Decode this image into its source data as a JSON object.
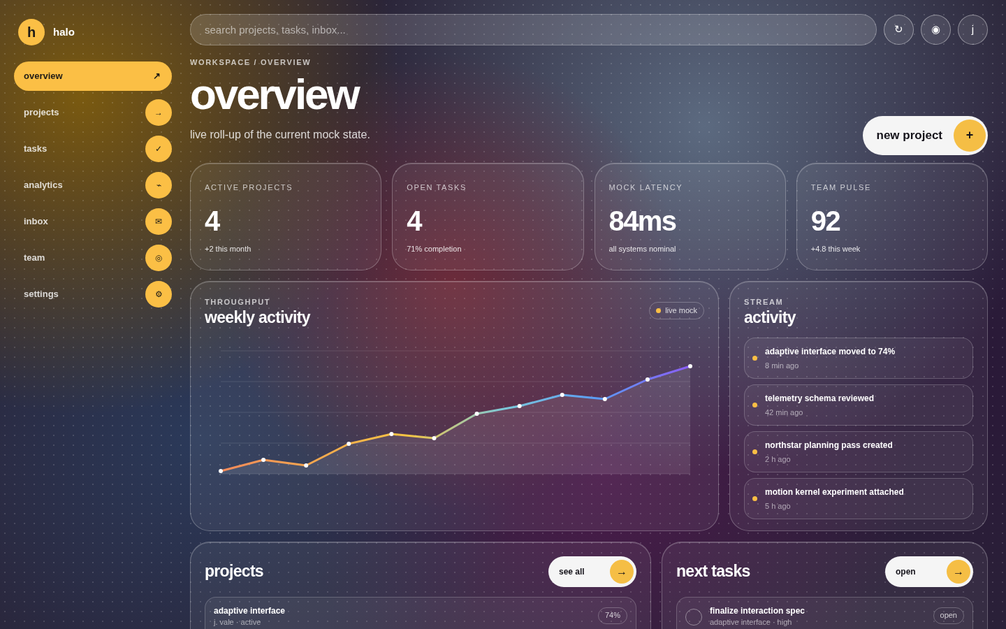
{
  "brand": {
    "logo": "h",
    "name": "halo"
  },
  "nav": [
    {
      "label": "overview",
      "icon": "↗",
      "selected": true
    },
    {
      "label": "projects",
      "icon": "→",
      "selected": false
    },
    {
      "label": "tasks",
      "icon": "✓",
      "selected": false
    },
    {
      "label": "analytics",
      "icon": "⌁",
      "selected": false
    },
    {
      "label": "inbox",
      "icon": "✉",
      "selected": false
    },
    {
      "label": "team",
      "icon": "◎",
      "selected": false
    },
    {
      "label": "settings",
      "icon": "⚙",
      "selected": false
    }
  ],
  "search": {
    "placeholder": "search projects, tasks, inbox..."
  },
  "top_buttons": [
    "↻",
    "◉",
    "j"
  ],
  "breadcrumb": "WORKSPACE / OVERVIEW",
  "title": "overview",
  "subtitle": "live roll-up of the current mock state.",
  "new_project": {
    "label": "new project",
    "icon": "+"
  },
  "stats": [
    {
      "label": "ACTIVE PROJECTS",
      "value": "4",
      "note": "+2 this month"
    },
    {
      "label": "OPEN TASKS",
      "value": "4",
      "note": "71% completion"
    },
    {
      "label": "MOCK LATENCY",
      "value": "84ms",
      "note": "all systems nominal"
    },
    {
      "label": "TEAM PULSE",
      "value": "92",
      "note": "+4.8 this week"
    }
  ],
  "throughput": {
    "eyebrow": "THROUGHPUT",
    "title": "weekly activity",
    "badge": "live mock"
  },
  "stream": {
    "eyebrow": "STREAM",
    "title": "activity",
    "items": [
      {
        "text": "adaptive interface moved to 74%",
        "time": "8 min ago"
      },
      {
        "text": "telemetry schema reviewed",
        "time": "42 min ago"
      },
      {
        "text": "northstar planning pass created",
        "time": "2 h ago"
      },
      {
        "text": "motion kernel experiment attached",
        "time": "5 h ago"
      }
    ]
  },
  "projects": {
    "title": "projects",
    "button": "see all",
    "button_icon": "→",
    "rows": [
      {
        "name": "adaptive interface",
        "meta": "j. vale · active",
        "progress": "74%"
      }
    ]
  },
  "next_tasks": {
    "title": "next tasks",
    "button": "open",
    "button_icon": "→",
    "rows": [
      {
        "name": "finalize interaction spec",
        "meta": "adaptive interface · high",
        "status": "open",
        "checked": false
      }
    ]
  }
}
